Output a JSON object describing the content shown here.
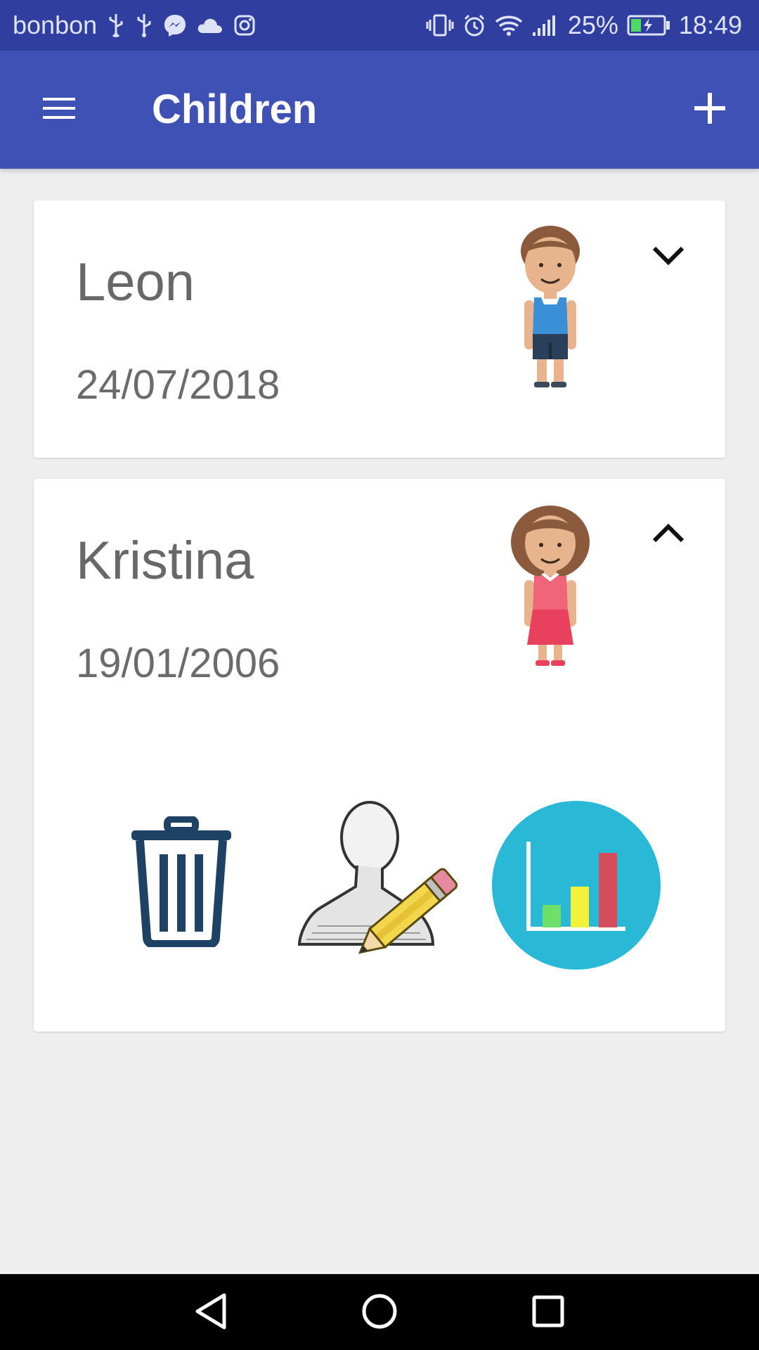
{
  "status_bar": {
    "carrier": "bonbon",
    "battery_percent": "25%",
    "time": "18:49",
    "left_icons": [
      "usb-icon",
      "usb-icon",
      "messenger-icon",
      "cloud-icon",
      "instagram-icon"
    ],
    "right_icons": [
      "vibrate-icon",
      "alarm-icon",
      "wifi-icon",
      "signal-icon",
      "battery-charging-icon"
    ]
  },
  "app_bar": {
    "title": "Children",
    "menu_icon": "hamburger-menu-icon",
    "add_icon": "plus-icon",
    "background_color": "#3f51b5",
    "status_color": "#303f9f"
  },
  "children": [
    {
      "name": "Leon",
      "birthdate": "24/07/2018",
      "avatar": "boy-avatar-icon",
      "expanded": false,
      "toggle_icon": "chevron-down-icon"
    },
    {
      "name": "Kristina",
      "birthdate": "19/01/2006",
      "avatar": "girl-avatar-icon",
      "expanded": true,
      "toggle_icon": "chevron-up-icon",
      "actions": [
        {
          "icon": "trash-icon"
        },
        {
          "icon": "edit-profile-icon"
        },
        {
          "icon": "bar-chart-icon"
        }
      ]
    }
  ],
  "nav_bar": {
    "buttons": [
      "back-icon",
      "home-icon",
      "recent-apps-icon"
    ]
  }
}
